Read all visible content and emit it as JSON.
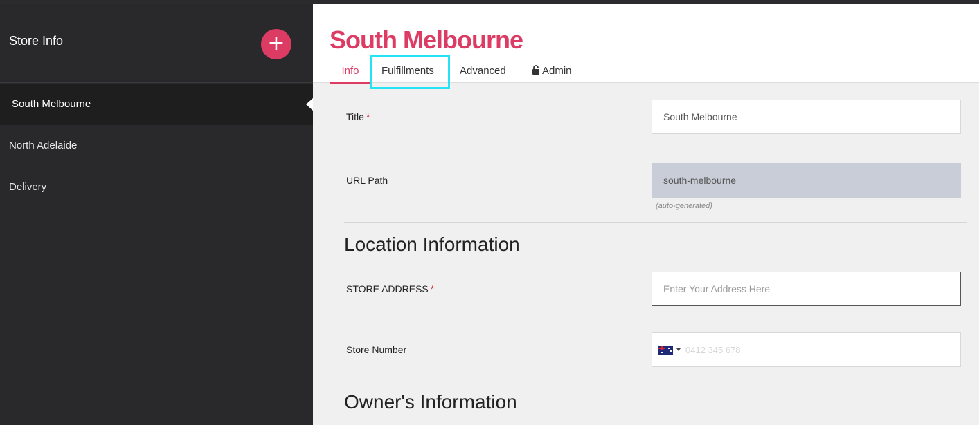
{
  "sidebar": {
    "title": "Store Info",
    "add_label": "+",
    "items": [
      {
        "label": "South Melbourne"
      },
      {
        "label": "North Adelaide"
      },
      {
        "label": "Delivery"
      }
    ]
  },
  "header": {
    "title": "South Melbourne",
    "tabs": [
      {
        "label": "Info"
      },
      {
        "label": "Fulfillments"
      },
      {
        "label": "Advanced"
      },
      {
        "label": "Admin",
        "icon": "unlock-icon"
      }
    ]
  },
  "form": {
    "title_label": "Title",
    "title_value": "South Melbourne",
    "url_label": "URL Path",
    "url_value": "south-melbourne",
    "url_hint": "(auto-generated)",
    "location_heading": "Location Information",
    "address_label": "STORE ADDRESS",
    "address_placeholder": "Enter Your Address Here",
    "number_label": "Store Number",
    "number_placeholder": "0412 345 678",
    "owner_heading": "Owner's Information",
    "required_mark": "*"
  },
  "colors": {
    "accent": "#dc3c64",
    "sidebar_bg": "#29292b",
    "highlight": "#24e3f2"
  }
}
